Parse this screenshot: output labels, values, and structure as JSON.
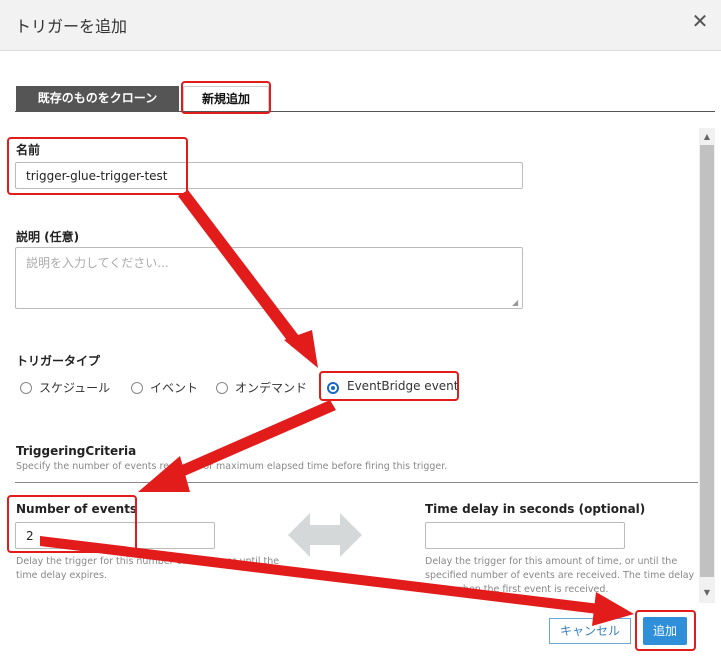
{
  "dialog": {
    "title": "トリガーを追加",
    "close_icon": "✕"
  },
  "tabs": {
    "clone_label": "既存のものをクローン",
    "new_label": "新規追加"
  },
  "form": {
    "name_label": "名前",
    "name_value": "trigger-glue-trigger-test",
    "description_label": "説明 (任意)",
    "description_placeholder": "説明を入力してください...",
    "trigger_type_label": "トリガータイプ",
    "trigger_types": [
      "スケジュール",
      "イベント",
      "オンデマンド",
      "EventBridge event"
    ],
    "selected_trigger_type": "EventBridge event"
  },
  "criteria": {
    "title": "TriggeringCriteria",
    "subtitle": "Specify the number of events received or maximum elapsed time before firing this trigger.",
    "events_label": "Number of events",
    "events_value": "2",
    "events_hint": "Delay the trigger for this number of events, or until the time delay expires.",
    "delay_label": "Time delay in seconds (optional)",
    "delay_value": "",
    "delay_hint": "Delay the trigger for this amount of time, or until the specified number of events are received. The time delay starts when the first event is received."
  },
  "footer": {
    "cancel_label": "キャンセル",
    "add_label": "追加"
  },
  "colors": {
    "highlight": "#e21b1b",
    "primary": "#2f8fd8",
    "tab_dark": "#555555"
  }
}
